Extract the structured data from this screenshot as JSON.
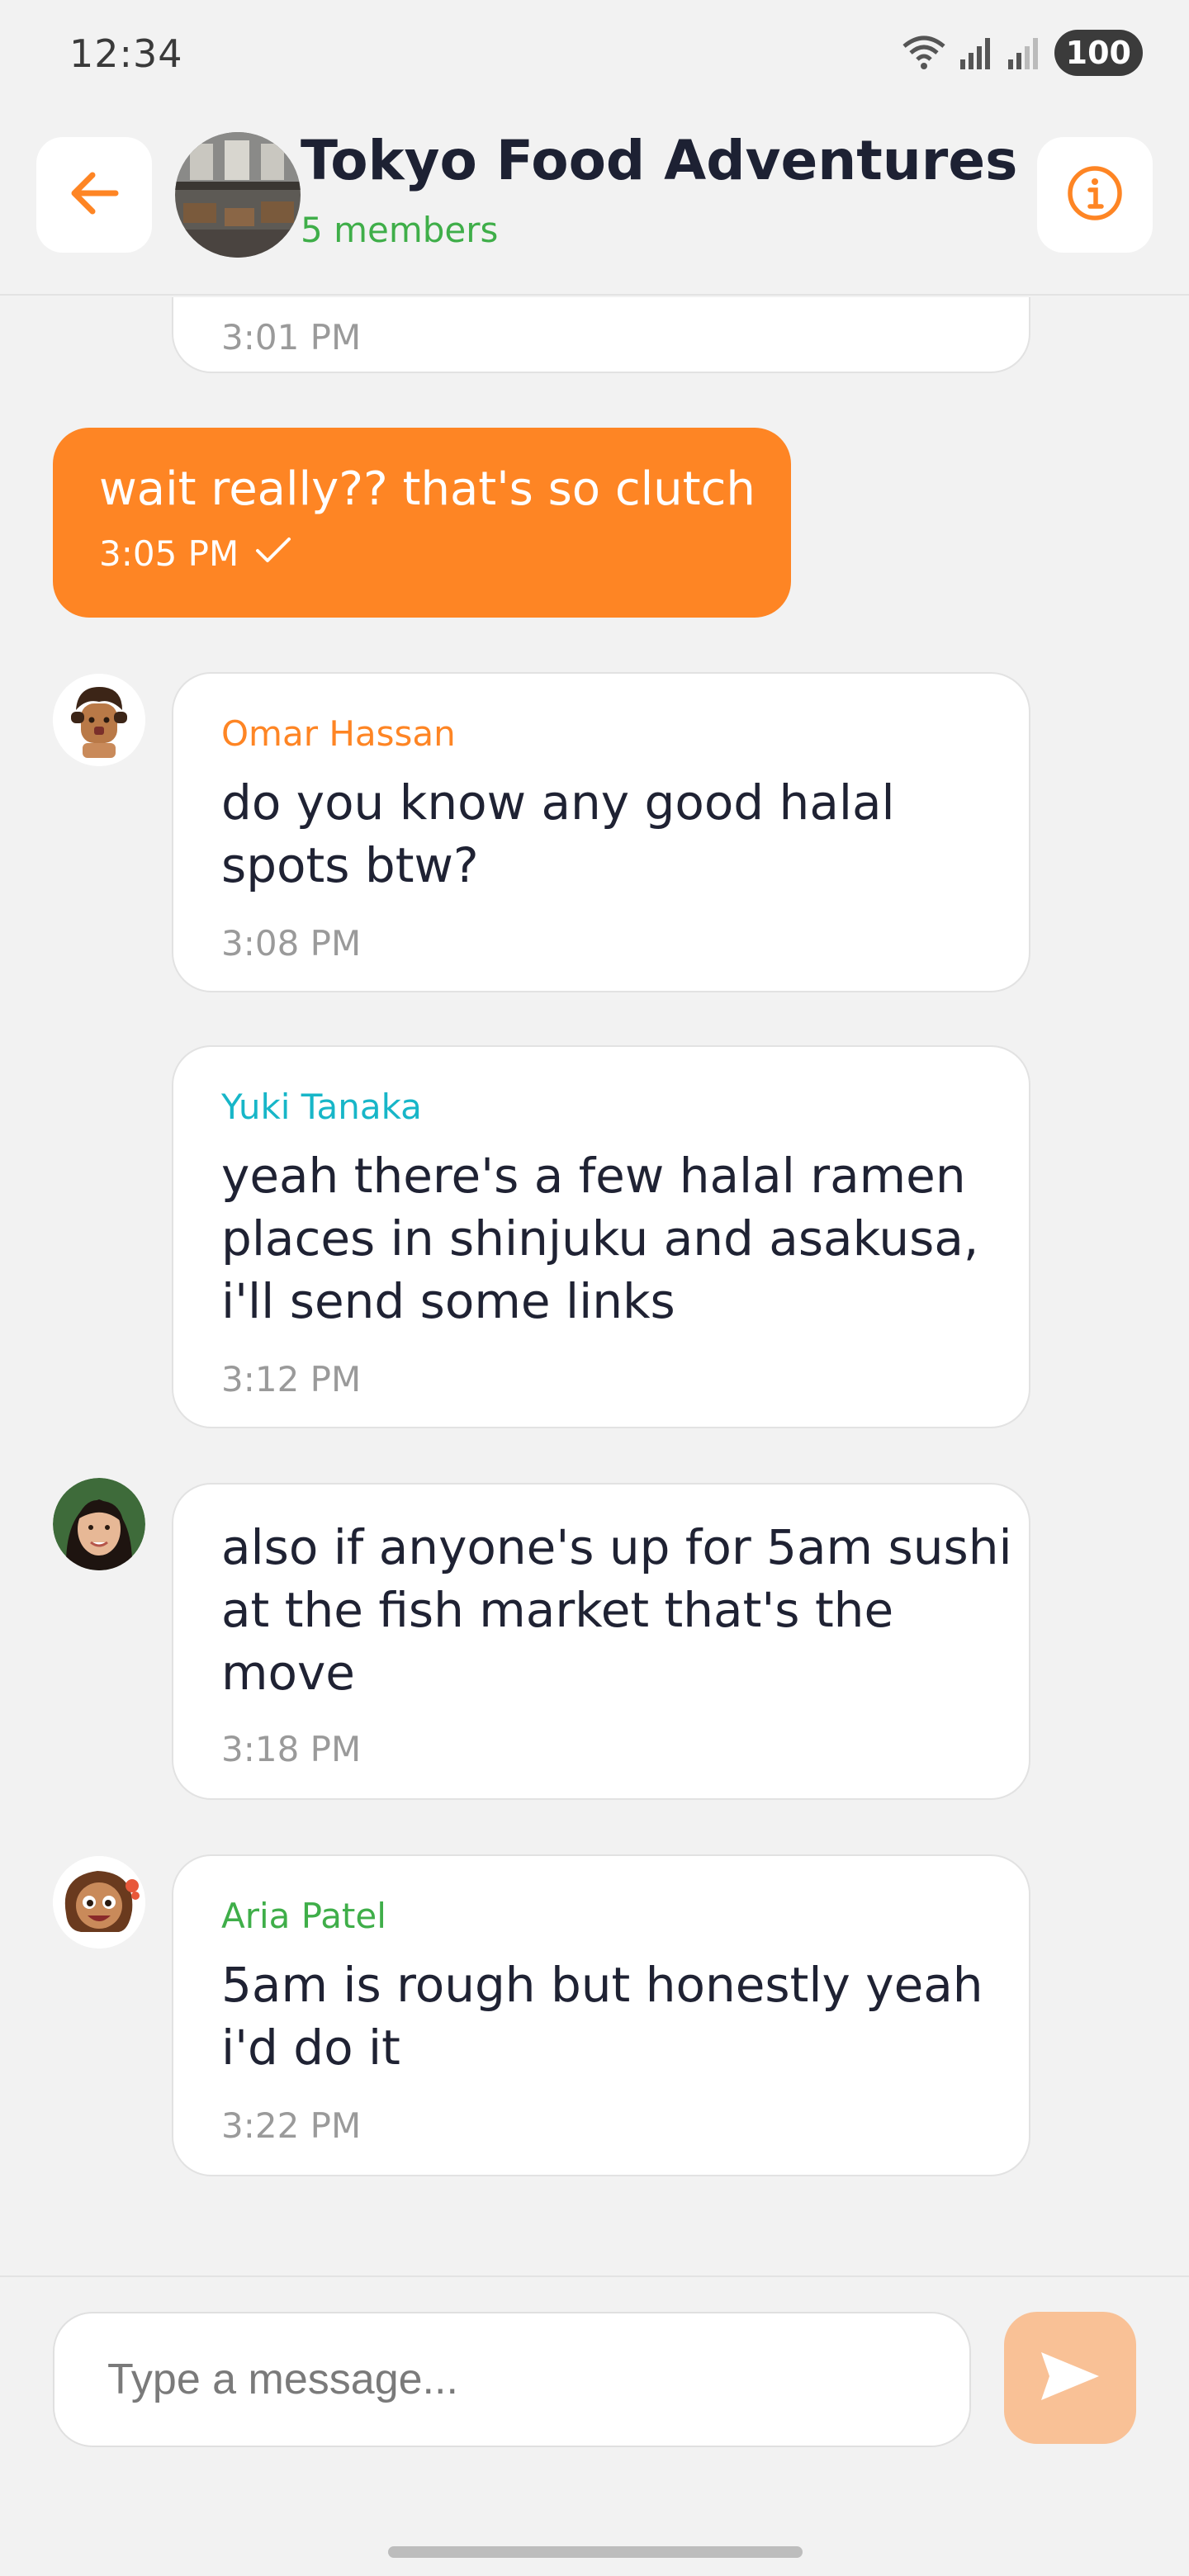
{
  "status_bar": {
    "time": "12:34",
    "battery": "100",
    "icons": [
      "wifi-icon",
      "signal-icon",
      "signal-weak-icon",
      "battery-icon"
    ]
  },
  "header": {
    "title": "Tokyo Food Adventures",
    "members": "5 members",
    "icons": [
      "arrow-left-icon",
      "group-photo-avatar",
      "info-icon"
    ]
  },
  "colors": {
    "accent": "#fe8524",
    "send_button": "#f9c196",
    "members_green": "#3fae49",
    "omar_name": "#fe8524",
    "yuki_name": "#17b6c8",
    "aria_name": "#3fae49"
  },
  "messages": [
    {
      "type": "incoming",
      "text": "",
      "time": "3:01 PM"
    },
    {
      "type": "outgoing",
      "text": "wait really?? that's so clutch",
      "time": "3:05 PM",
      "status_icon": "check-icon"
    },
    {
      "type": "incoming",
      "sender": "Omar Hassan",
      "text": "do you know any good halal\nspots btw?",
      "time": "3:08 PM"
    },
    {
      "type": "incoming",
      "sender": "Yuki Tanaka",
      "text": "yeah there's a few halal ramen\nplaces in shinjuku and asakusa,\ni'll send some links",
      "time": "3:12 PM"
    },
    {
      "type": "incoming",
      "text": "also if anyone's up for 5am sushi\nat the fish market that's the\nmove",
      "time": "3:18 PM"
    },
    {
      "type": "incoming",
      "sender": "Aria Patel",
      "text": "5am is rough but honestly yeah\ni'd do it",
      "time": "3:22 PM"
    }
  ],
  "composer": {
    "placeholder": "Type a message...",
    "send_icon": "send-icon"
  }
}
